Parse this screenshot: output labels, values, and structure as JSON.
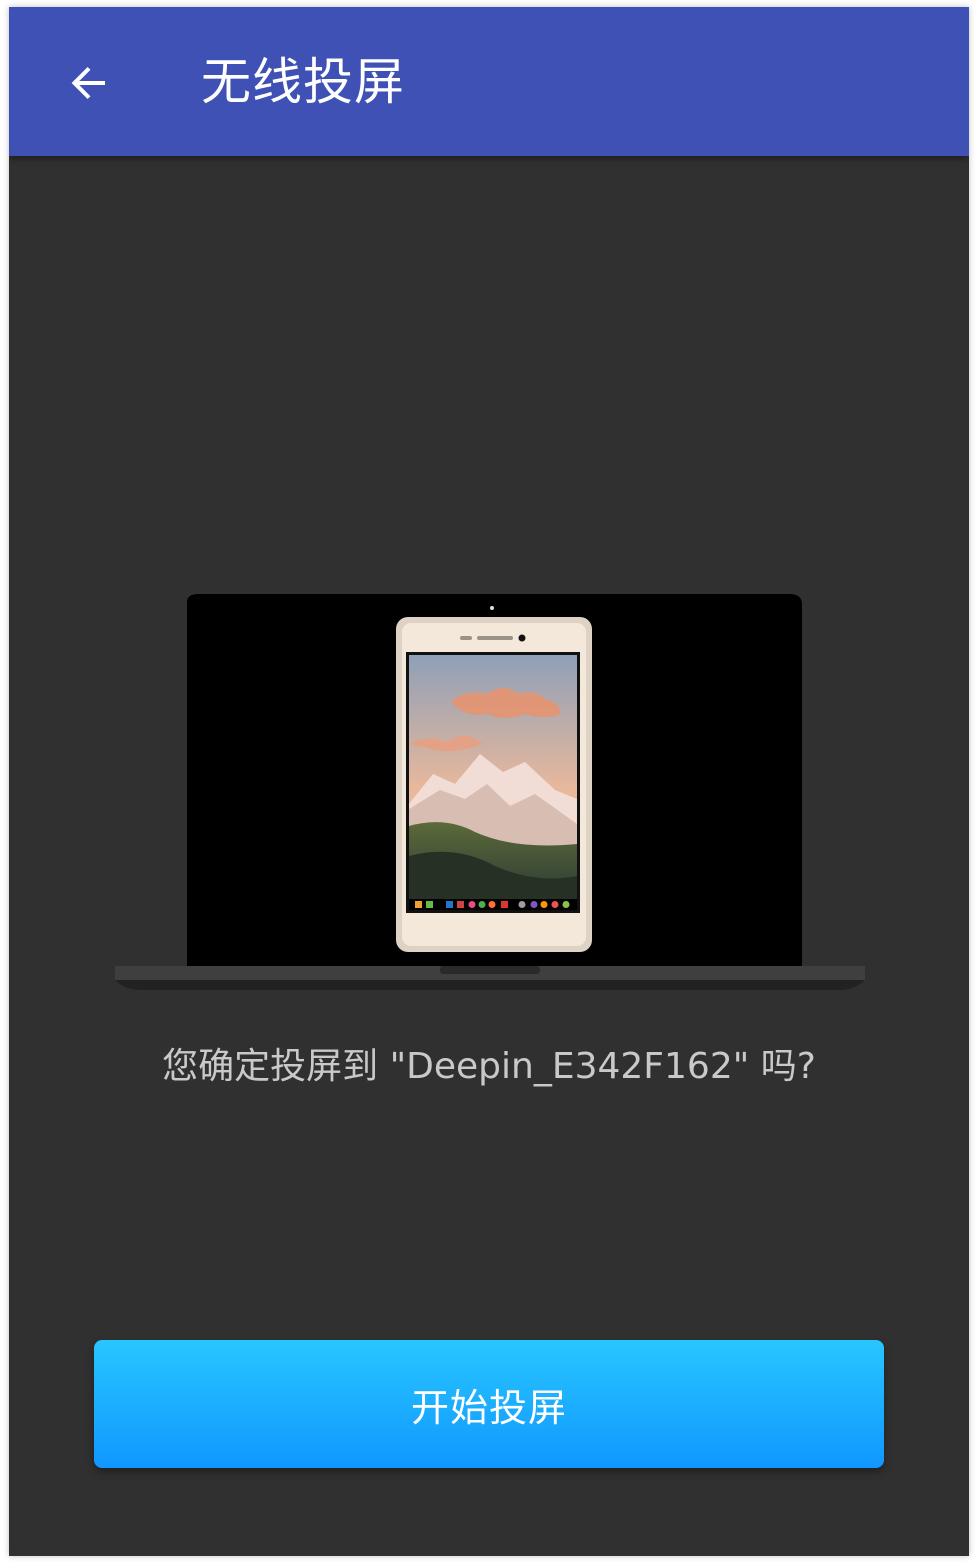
{
  "app_bar": {
    "back_icon": "arrow-back-icon",
    "title": "无线投屏"
  },
  "illustration": {
    "laptop_icon": "laptop-icon",
    "phone_icon": "phone-icon",
    "wallpaper": "mountain-sunset-wallpaper",
    "dock_icons": [
      "folder-icon",
      "note-icon",
      "flag-icon",
      "calendar-icon",
      "paint-icon",
      "chrome-icon",
      "photos-icon",
      "gear-icon",
      "music-icon",
      "store-icon",
      "app-icon"
    ]
  },
  "confirm": {
    "question": "您确定投屏到 \"Deepin_E342F162\" 吗?"
  },
  "actions": {
    "start_label": "开始投屏"
  },
  "colors": {
    "app_bar": "#3f51b5",
    "background": "#303030",
    "button_top": "#28c6ff",
    "button_bottom": "#1097ff",
    "question_text": "#c9c9c9"
  }
}
